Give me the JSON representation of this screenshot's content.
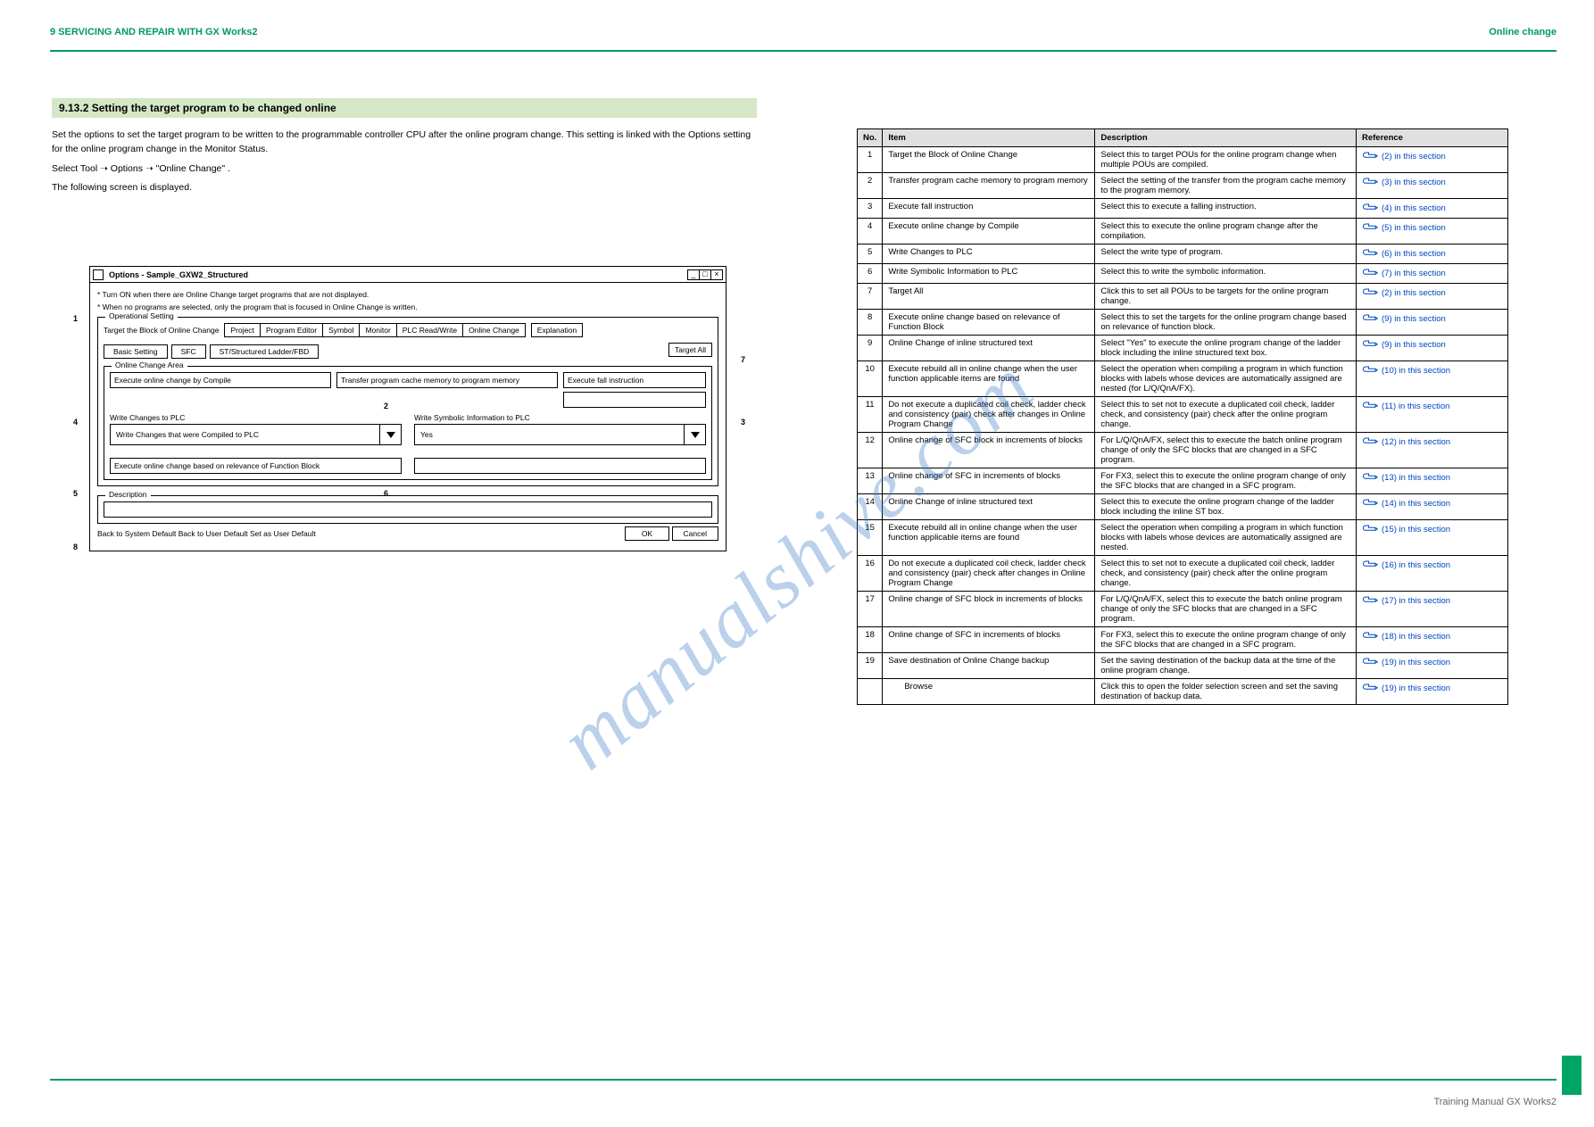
{
  "page": {
    "chapter_header": "9   SERVICING AND REPAIR WITH GX Works2",
    "chapter_sub": "Online change",
    "footer": "Training Manual GX Works2",
    "watermark": "manualshive.com"
  },
  "section": {
    "title": "9.13.2    Setting the target program to be changed online"
  },
  "left": {
    "p1": "Set the options to set the target program to be written to the programmable controller CPU after the online program change. This setting is linked with the Options setting for the online program change in the Monitor Status.",
    "p2": "Select  Tool ➝ Options ➝ \"Online Change\" .",
    "p3": "The following screen is displayed."
  },
  "dialog": {
    "title": "Options - Sample_GXW2_Structured",
    "note1": "*  Turn ON when there are Online Change target programs that are not displayed.",
    "note2": "*  When no programs are selected, only the program that is focused in Online Change is written.",
    "panel_label": "Operational Setting",
    "tabs": [
      "Project",
      "Program Editor",
      "Symbol",
      "Monitor",
      "PLC Read/Write",
      "Online Change"
    ],
    "reset_btn": "Explanation",
    "subtabs": [
      "Basic Setting",
      "SFC",
      "ST/Structured Ladder/FBD"
    ],
    "target_label": "Target the Block of Online Change",
    "target_btn": "Target All",
    "area": {
      "panel_label": "Online Change Area",
      "field1_lbl": "Execute online change by Compile",
      "field2_lbl": "Transfer program cache memory to program memory",
      "field3_lbl": "Execute fall instruction"
    },
    "dd1": {
      "label": "Write Changes to PLC",
      "value": "Write Changes that were Compiled to PLC"
    },
    "dd2": {
      "label": "Write Symbolic Information to PLC",
      "value": "Yes"
    },
    "bottom1_lbl": "Execute online change based on relevance of Function Block",
    "bottom2_lbl": "",
    "desc_panel": "Description",
    "back_default": "Back to System Default    Back to User Default    Set as User Default",
    "ok": "OK",
    "cancel": "Cancel"
  },
  "callouts": [
    "1",
    "2",
    "3",
    "4",
    "5",
    "6",
    "7",
    "8"
  ],
  "table": {
    "head": [
      "No.",
      "Item",
      "Description",
      "Reference"
    ],
    "rows": [
      {
        "no": "1",
        "item": "Target the Block of Online Change",
        "desc": "Select this to target POUs for the online program change when multiple POUs are compiled.",
        "ref": "(2) in this section"
      },
      {
        "no": "2",
        "item": "Transfer program cache memory to program memory",
        "desc": "Select the setting of the transfer from the program cache memory to the program memory.",
        "ref": "(3) in this section"
      },
      {
        "no": "3",
        "item": "Execute fall instruction",
        "desc": "Select this to execute a falling instruction.",
        "ref": "(4) in this section"
      },
      {
        "no": "4",
        "item": "Execute online change by Compile",
        "desc": "Select this to execute the online program change after the compilation.",
        "ref": "(5) in this section"
      },
      {
        "no": "5",
        "item": "Write Changes to PLC",
        "desc": "Select the write type of program.",
        "ref": "(6) in this section"
      },
      {
        "no": "6",
        "item": "Write Symbolic Information to PLC",
        "desc": "Select this to write the symbolic information.",
        "ref": "(7) in this section"
      },
      {
        "no": "7",
        "item": "Target All",
        "desc": "Click this to set all POUs to be targets for the online program change.",
        "ref": "(2) in this section"
      },
      {
        "no": "8",
        "item": "Execute online change based on relevance of Function Block",
        "desc": "Select this to set the targets for the online program change based on relevance of function block.",
        "ref": "(9) in this section"
      },
      {
        "no": "9",
        "item": "Online Change of inline structured text",
        "desc": "Select \"Yes\" to execute the online program change of the ladder block including the inline structured text box.",
        "ref": "(9) in this section"
      },
      {
        "no": "10",
        "item": "Execute rebuild all in online change when the user function applicable items are found",
        "desc": "Select the operation when compiling a program in which function blocks with labels whose devices are automatically assigned are nested (for L/Q/QnA/FX).",
        "ref": "(10) in this section"
      },
      {
        "no": "11",
        "item": "Do not execute a duplicated coil check, ladder check and consistency (pair) check after changes in Online Program Change",
        "desc": "Select this to set not to execute a duplicated coil check, ladder check, and consistency (pair) check after the online program change.",
        "ref": "(11) in this section"
      },
      {
        "no": "12",
        "item": "Online change of SFC block in increments of blocks",
        "desc": "For L/Q/QnA/FX, select this to execute the batch online program change of only the SFC blocks that are changed in a SFC program.",
        "ref": "(12) in this section"
      },
      {
        "no": "13",
        "item": "Online change of SFC in increments of blocks",
        "desc": "For FX3, select this to execute the online program change of only the SFC blocks that are changed in a SFC program.",
        "ref": "(13) in this section"
      },
      {
        "no": "14",
        "item": "Online Change of inline structured text",
        "desc": "Select this to execute the online program change of the ladder block including the inline ST box.",
        "ref": "(14) in this section"
      },
      {
        "no": "15",
        "item": "Execute rebuild all in online change when the user function applicable items are found",
        "desc": "Select the operation when compiling a program in which function blocks with labels whose devices are automatically assigned are nested.",
        "ref": "(15) in this section"
      },
      {
        "no": "16",
        "item": "Do not execute a duplicated coil check, ladder check and consistency (pair) check after changes in Online Program Change",
        "desc": "Select this to set not to execute a duplicated coil check, ladder check, and consistency (pair) check after the online program change.",
        "ref": "(16) in this section"
      },
      {
        "no": "17",
        "item": "Online change of SFC block in increments of blocks",
        "desc": "For L/Q/QnA/FX, select this to execute the batch online program change of only the SFC blocks that are changed in a SFC program.",
        "ref": "(17) in this section"
      },
      {
        "no": "18",
        "item": "Online change of SFC in increments of blocks",
        "desc": "For FX3, select this to execute the online program change of only the SFC blocks that are changed in a SFC program.",
        "ref": "(18) in this section"
      },
      {
        "no": "19",
        "item": "Save destination of Online Change backup",
        "desc": "Set the saving destination of the backup data at the time of the online program change.",
        "ref": "(19) in this section"
      }
    ],
    "sub": {
      "item": "Browse",
      "desc": "Click this to open the folder selection screen and set the saving destination of backup data.",
      "ref": "(19) in this section"
    }
  }
}
